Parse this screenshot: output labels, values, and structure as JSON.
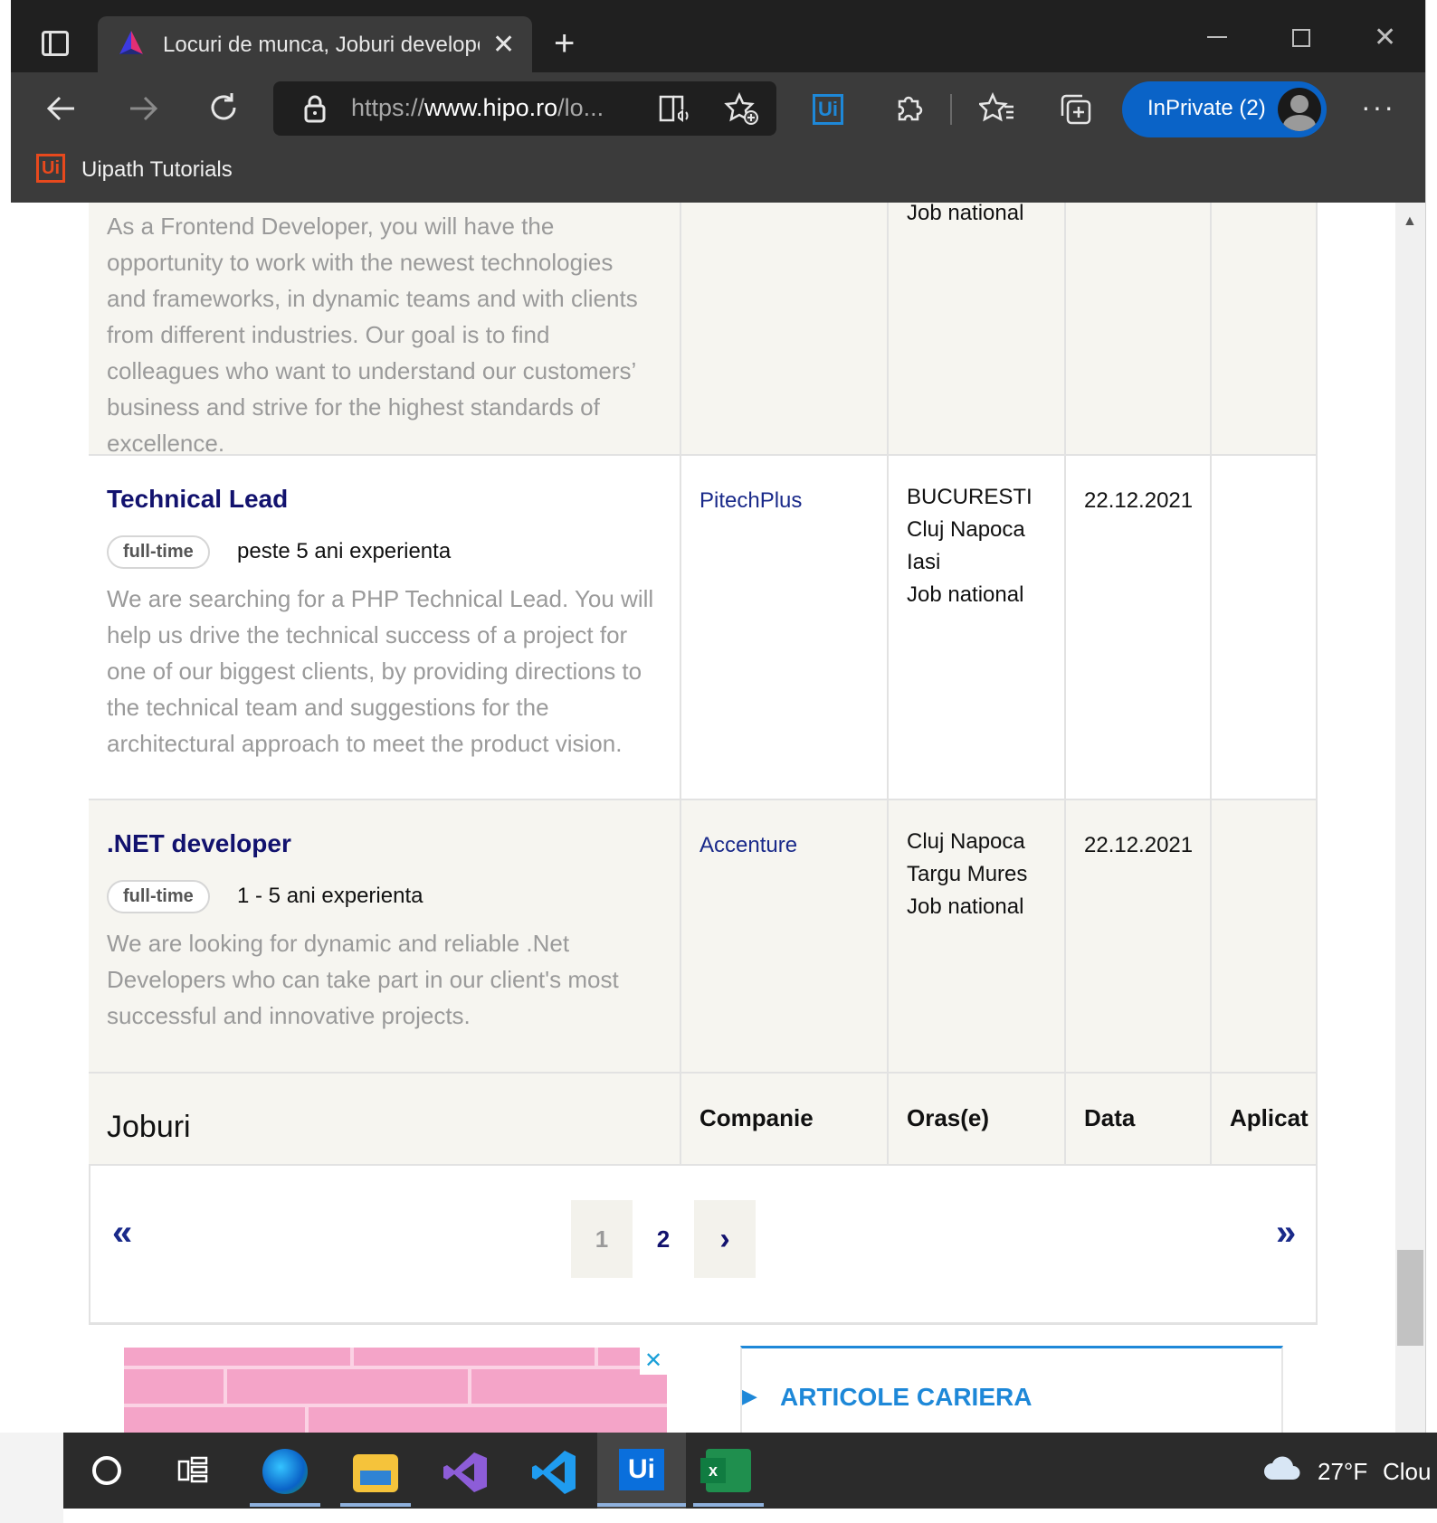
{
  "browser": {
    "tab_title": "Locuri de munca, Joburi developer",
    "url": "https://www.hipo.ro/lo...",
    "url_prefix": "https://",
    "url_domain": "www.hipo.ro",
    "url_suffix": "/lo...",
    "inprivate_label": "InPrivate (2)",
    "favorites": [
      {
        "label": "Uipath Tutorials"
      }
    ],
    "more_label": "···"
  },
  "jobs": {
    "first_row": {
      "description": "As a Frontend Developer, you will have the opportunity to work with the newest technologies and frameworks, in dynamic teams and with clients from different industries. Our goal is to find colleagues who want to understand our customers’ business and strive for the highest standards of excellence.",
      "city_last": "Job national"
    },
    "rows": [
      {
        "title": "Technical Lead",
        "type": "full-time",
        "experience": "peste 5 ani experienta",
        "description": "We are searching for a PHP Technical Lead. You will help us drive the technical success of a project for one of our biggest clients, by providing directions to the technical team and suggestions for the architectural approach to meet the product vision.",
        "company": "PitechPlus",
        "cities": [
          "BUCURESTI",
          "Cluj Napoca",
          "Iasi",
          "Job national"
        ],
        "date": "22.12.2021"
      },
      {
        "title": ".NET developer",
        "type": "full-time",
        "experience": "1 - 5 ani experienta",
        "description": "We are looking for dynamic and reliable .Net Developers who can take part in our client's most successful and innovative projects.",
        "company": "Accenture",
        "cities": [
          "Cluj Napoca",
          "Targu Mures",
          "Job national"
        ],
        "date": "22.12.2021"
      }
    ],
    "footer_headers": {
      "jobs": "Joburi",
      "company": "Companie",
      "cities": "Oras(e)",
      "date": "Data",
      "applied": "Aplicat"
    }
  },
  "pagination": {
    "first": "«",
    "pages": [
      "1",
      "2"
    ],
    "current": "2",
    "next": "›",
    "last": "»"
  },
  "sidebar": {
    "articles_title": "ARTICOLE CARIERA",
    "ad_close": "✕"
  },
  "taskbar": {
    "weather": "27°F",
    "weather_desc": "Clou"
  },
  "colors": {
    "chrome": "#3b3b3b",
    "tabstrip": "#202020",
    "accent_blue": "#0a63c7",
    "job_title": "#12126e",
    "articles_blue": "#1e88d8",
    "beige_row": "#f6f5f0",
    "uipath_orange": "#e8491d"
  }
}
